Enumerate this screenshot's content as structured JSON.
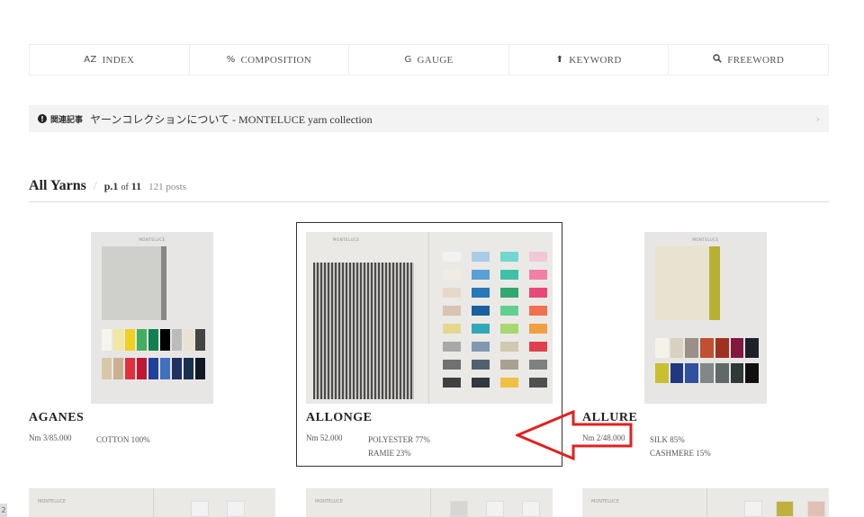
{
  "nav": {
    "items": [
      {
        "icon": "AZ",
        "label": "INDEX"
      },
      {
        "icon": "%",
        "label": "COMPOSITION"
      },
      {
        "icon": "G",
        "label": "GAUGE"
      },
      {
        "icon": "⬆",
        "label": "KEYWORD"
      },
      {
        "icon": "🔍",
        "label": "FREEWORD"
      }
    ]
  },
  "related": {
    "label": "関連記事",
    "text": "ヤーンコレクションについて - MONTELUCE yarn collection"
  },
  "heading": {
    "title": "All Yarns",
    "page_prefix": "p.1",
    "page_of": "of",
    "page_total": "11",
    "count": "121 posts"
  },
  "cards": [
    {
      "name": "AGANES",
      "nm": "Nm 3/85.000",
      "comp": [
        "COTTON 100%"
      ]
    },
    {
      "name": "ALLONGE",
      "nm": "Nm 52.000",
      "comp": [
        "POLYESTER 77%",
        "RAMIE 23%"
      ]
    },
    {
      "name": "ALLURE",
      "nm": "Nm 2/48.000",
      "comp": [
        "SILK 85%",
        "CASHMERE 15%"
      ]
    }
  ],
  "sample": {
    "brand": "MONTELUCE"
  },
  "page_tab": "2",
  "colors": {
    "accent_arrow": "#e02020"
  }
}
